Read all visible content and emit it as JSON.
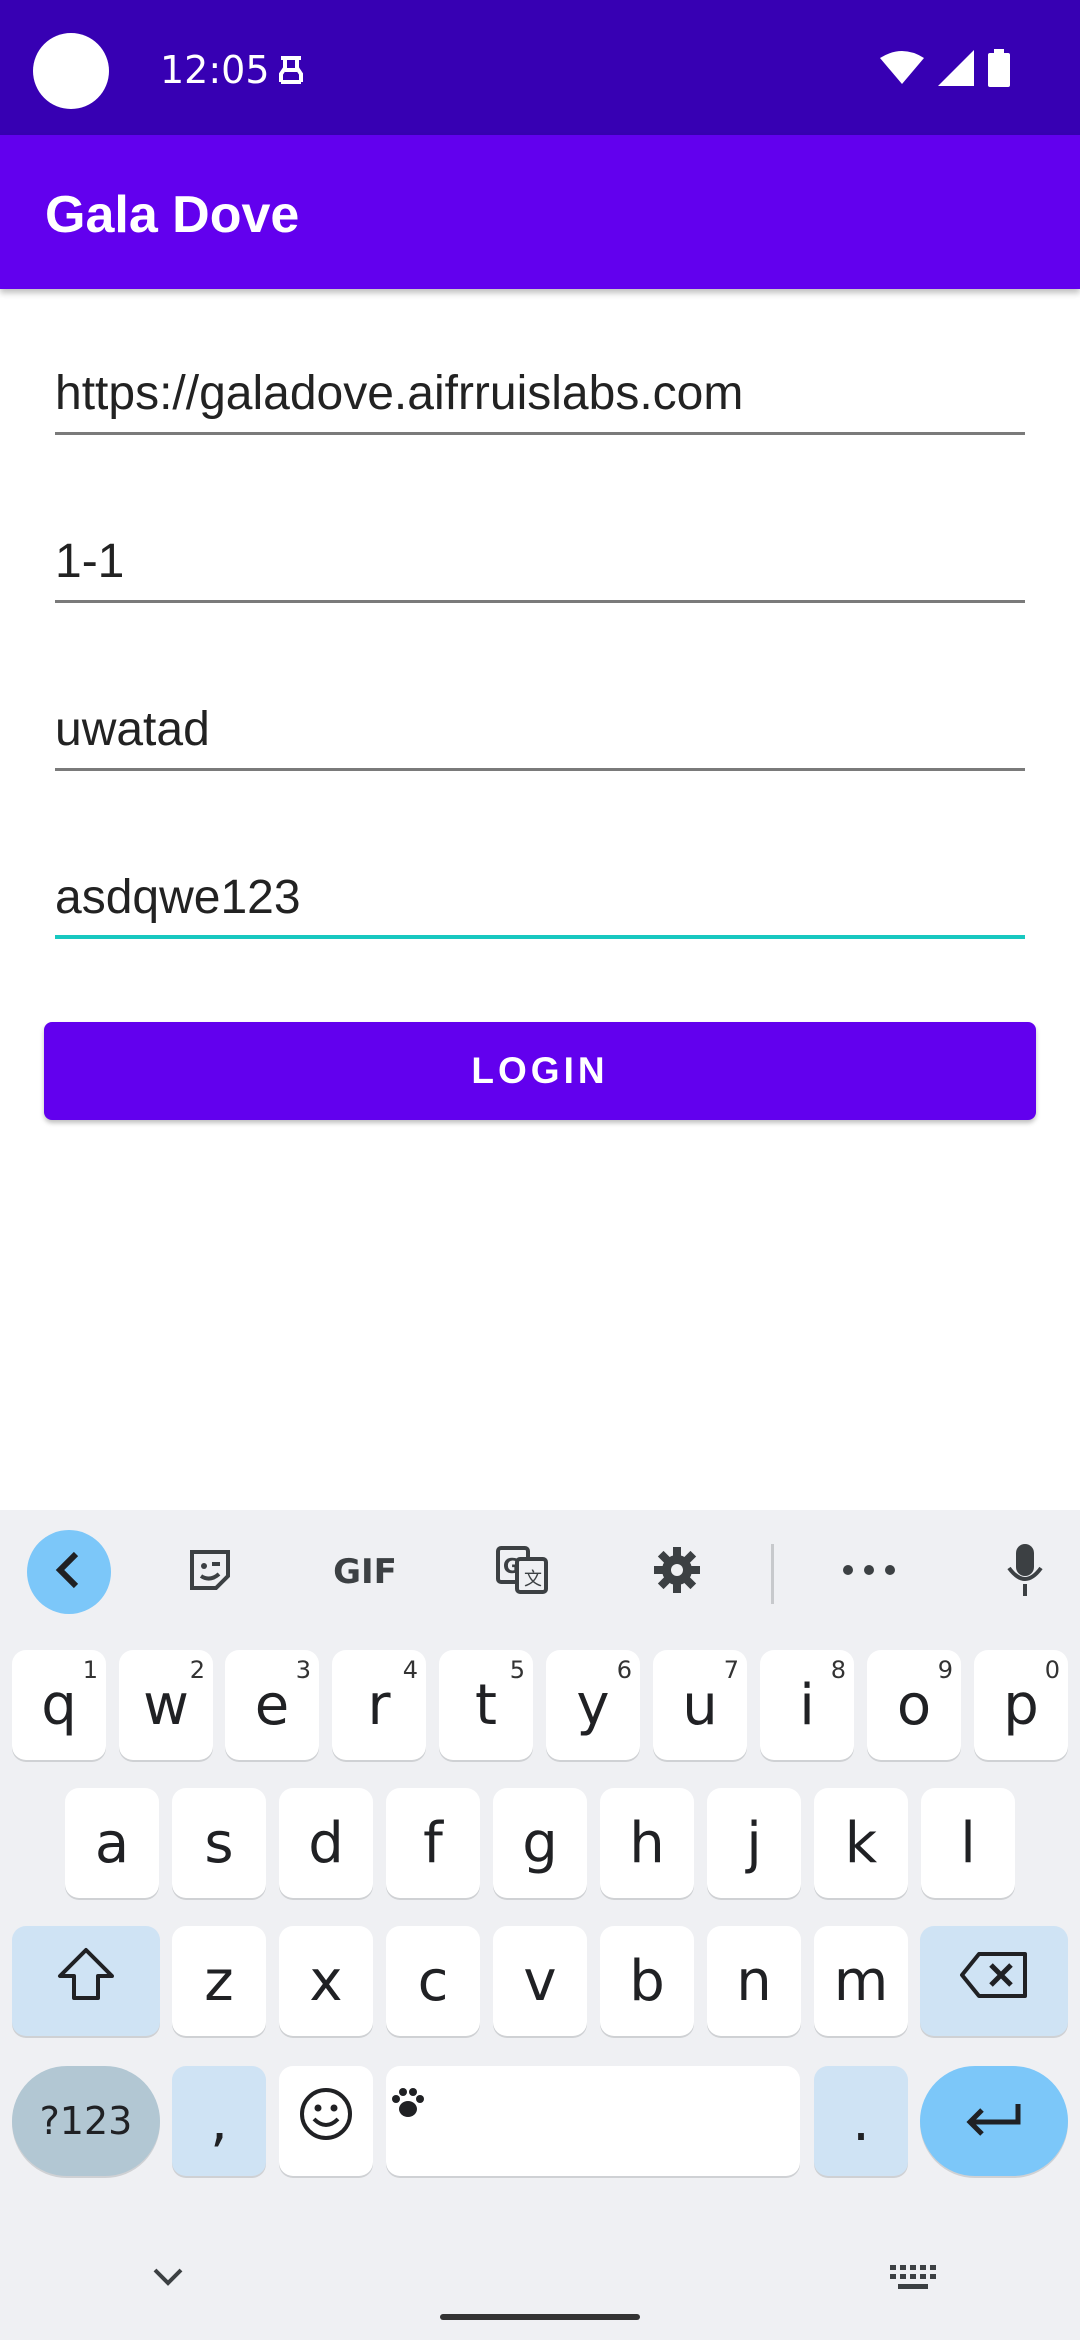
{
  "status_bar": {
    "time": "12:05"
  },
  "app_bar": {
    "title": "Gala Dove"
  },
  "form": {
    "server_url": "https://galadove.aifrruislabs.com",
    "field_two": "1-1",
    "username": "uwatad",
    "password": "asdqwe123",
    "login_label": "LOGIN"
  },
  "keyboard": {
    "toolbar": {
      "gif_label": "GIF"
    },
    "row1": [
      {
        "k": "q",
        "n": "1"
      },
      {
        "k": "w",
        "n": "2"
      },
      {
        "k": "e",
        "n": "3"
      },
      {
        "k": "r",
        "n": "4"
      },
      {
        "k": "t",
        "n": "5"
      },
      {
        "k": "y",
        "n": "6"
      },
      {
        "k": "u",
        "n": "7"
      },
      {
        "k": "i",
        "n": "8"
      },
      {
        "k": "o",
        "n": "9"
      },
      {
        "k": "p",
        "n": "0"
      }
    ],
    "row2": [
      "a",
      "s",
      "d",
      "f",
      "g",
      "h",
      "j",
      "k",
      "l"
    ],
    "row3": [
      "z",
      "x",
      "c",
      "v",
      "b",
      "n",
      "m"
    ],
    "symbols_label": "?123",
    "comma_label": ",",
    "period_label": "."
  },
  "colors": {
    "status_bar": "#3700b3",
    "primary": "#6200ee",
    "focus_underline": "#18c8c0",
    "keyboard_bg": "#eff0f3",
    "key_action": "#7cc7f9"
  }
}
